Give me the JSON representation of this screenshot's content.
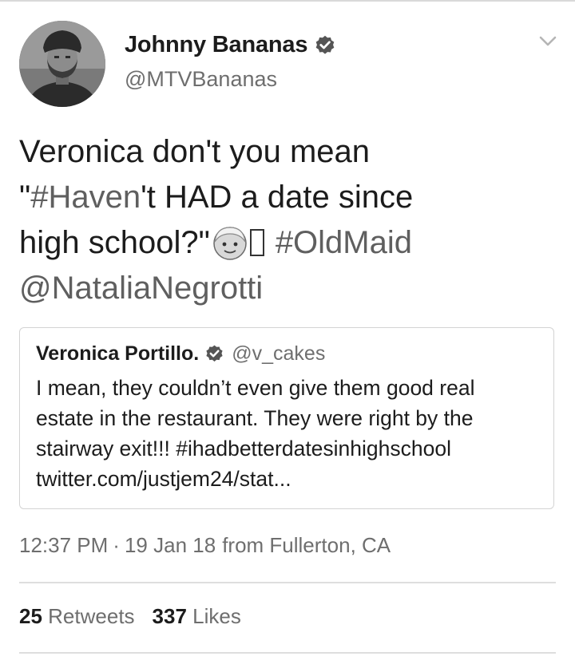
{
  "tweet": {
    "author_name": "Johnny Bananas",
    "author_handle": "@MTVBananas",
    "text_line1": "Veronica don't you mean",
    "text_line2_a": "\"",
    "text_line2_hashtag": "#Haven",
    "text_line2_b": "'t HAD a date since",
    "text_line3_a": "high school?\"",
    "text_line3_hashtag": "#OldMaid",
    "text_line4_mention": "@NataliaNegrotti"
  },
  "quoted_tweet": {
    "author_name": "Veronica Portillo.",
    "author_handle": "@v_cakes",
    "line1": "I mean, they couldn’t even give them good real",
    "line2": "estate in the restaurant.  They were right by the",
    "line3": "stairway exit!!!  #ihadbetterdatesinhighschool",
    "line4": "twitter.com/justjem24/stat..."
  },
  "meta": {
    "time": "12:37 PM",
    "separator": "·",
    "date": "19 Jan 18",
    "source": "from Fullerton, CA"
  },
  "stats": {
    "retweets_count": "25",
    "retweets_label": "Retweets",
    "likes_count": "337",
    "likes_label": "Likes"
  },
  "icons": {
    "verified": "verified-badge-icon",
    "menu": "chevron-down-icon",
    "emoji": "older-woman-emoji"
  },
  "colors": {
    "text": "#1c1c1c",
    "secondary": "#6e6e6e",
    "link": "#5f5f5f",
    "border": "#d3d3d3"
  }
}
